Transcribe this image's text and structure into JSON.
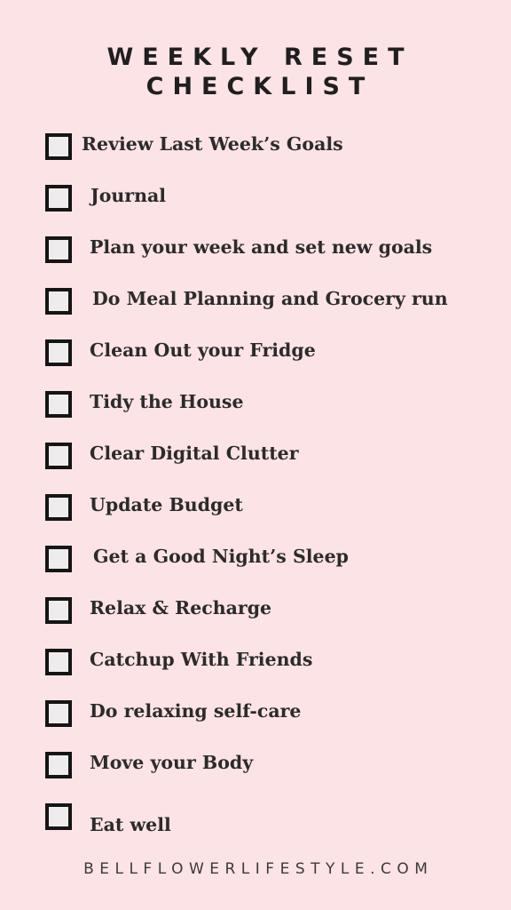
{
  "page": {
    "background_color": "#fce3e5",
    "text_color": "#2b2b2b",
    "title_color": "#201f1f",
    "checkbox_fill": "#eeecec",
    "checkbox_border": "#151515"
  },
  "title": {
    "line1": "WEEKLY RESET",
    "line2": "CHECKLIST"
  },
  "checklist": {
    "items": [
      {
        "label": "Review Last Week’s Goals",
        "checked": false
      },
      {
        "label": "Journal",
        "checked": false
      },
      {
        "label": "Plan your week and set new goals",
        "checked": false
      },
      {
        "label": "Do Meal Planning and Grocery run",
        "checked": false
      },
      {
        "label": "Clean Out your Fridge",
        "checked": false
      },
      {
        "label": "Tidy the House",
        "checked": false
      },
      {
        "label": "Clear Digital Clutter",
        "checked": false
      },
      {
        "label": "Update Budget",
        "checked": false
      },
      {
        "label": "Get a Good Night’s Sleep",
        "checked": false
      },
      {
        "label": "Relax & Recharge",
        "checked": false
      },
      {
        "label": "Catchup With Friends",
        "checked": false
      },
      {
        "label": "Do relaxing self-care",
        "checked": false
      },
      {
        "label": "Move your Body",
        "checked": false
      },
      {
        "label": "Eat well",
        "checked": false
      }
    ]
  },
  "footer": {
    "website": "BELLFLOWERLIFESTYLE.COM"
  }
}
